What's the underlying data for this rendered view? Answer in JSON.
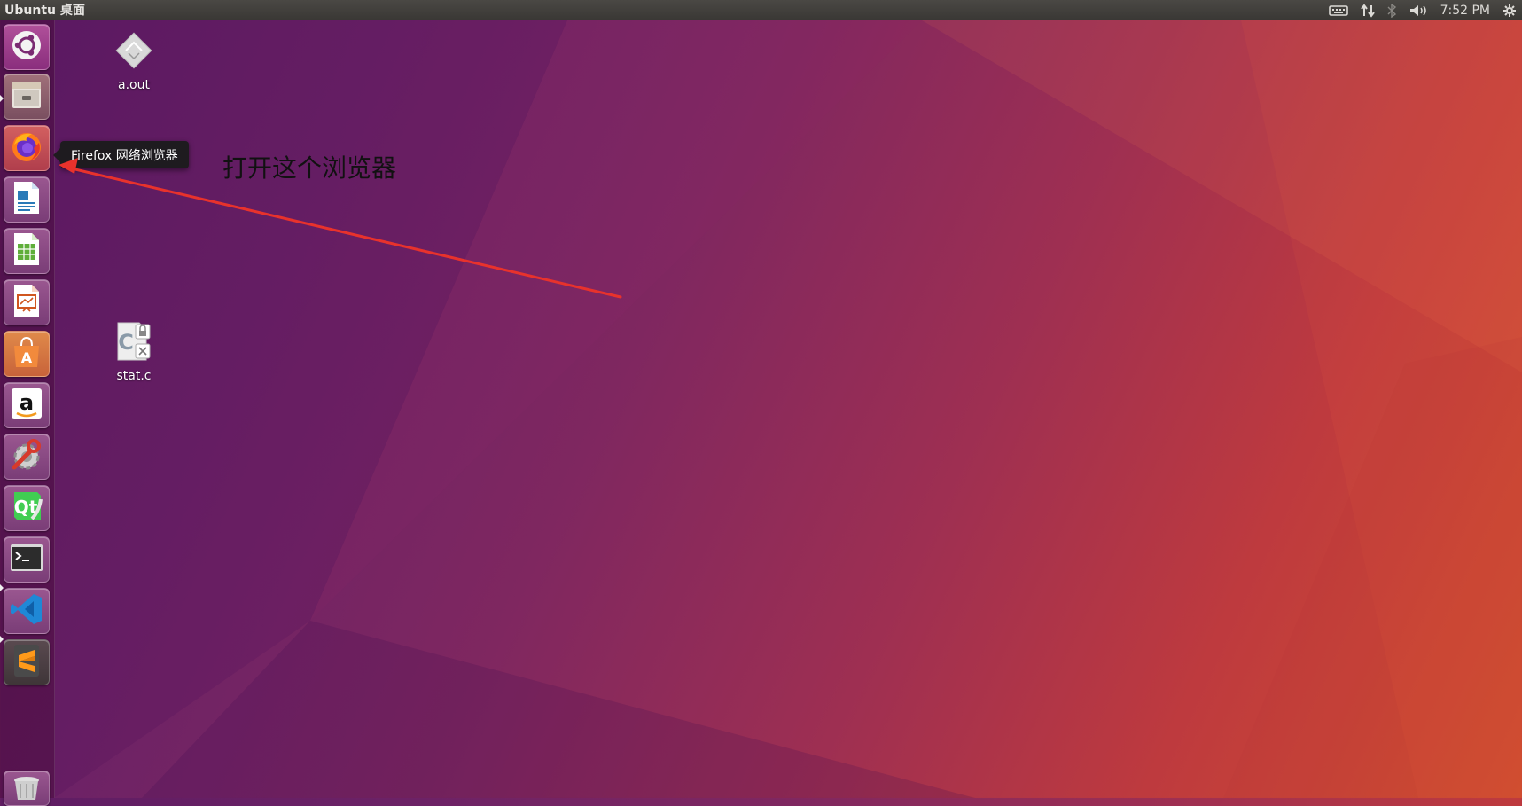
{
  "panel": {
    "title": "Ubuntu 桌面",
    "time": "7:52 PM"
  },
  "launcher": {
    "items": [
      {
        "name": "dash-home",
        "icon": "ubuntu-logo-icon"
      },
      {
        "name": "files",
        "icon": "file-cabinet-icon"
      },
      {
        "name": "firefox",
        "icon": "firefox-icon",
        "tooltip": "Firefox 网络浏览器"
      },
      {
        "name": "libreoffice-writer",
        "icon": "writer-document-icon"
      },
      {
        "name": "libreoffice-calc",
        "icon": "calc-spreadsheet-icon"
      },
      {
        "name": "libreoffice-impress",
        "icon": "impress-presentation-icon"
      },
      {
        "name": "ubuntu-software",
        "icon": "software-center-bag-icon"
      },
      {
        "name": "amazon",
        "icon": "amazon-icon"
      },
      {
        "name": "system-settings",
        "icon": "settings-wrench-icon"
      },
      {
        "name": "qt-creator",
        "icon": "qt-icon"
      },
      {
        "name": "terminal",
        "icon": "terminal-icon"
      },
      {
        "name": "vscode",
        "icon": "vscode-icon"
      },
      {
        "name": "sublime-text",
        "icon": "sublime-icon"
      },
      {
        "name": "trash",
        "icon": "trash-icon"
      }
    ]
  },
  "desktop": {
    "icons": [
      {
        "label": "a.out",
        "icon": "executable-diamond-icon"
      },
      {
        "label": "stat.c",
        "icon": "locked-source-file-icon"
      }
    ]
  },
  "annotation": {
    "text": "打开这个浏览器",
    "arrow_color": "#e8322c"
  },
  "colors": {
    "wallpaper_left": "#5e1c63",
    "wallpaper_right": "#d2502e",
    "panel_bg": "#3c3b37"
  }
}
